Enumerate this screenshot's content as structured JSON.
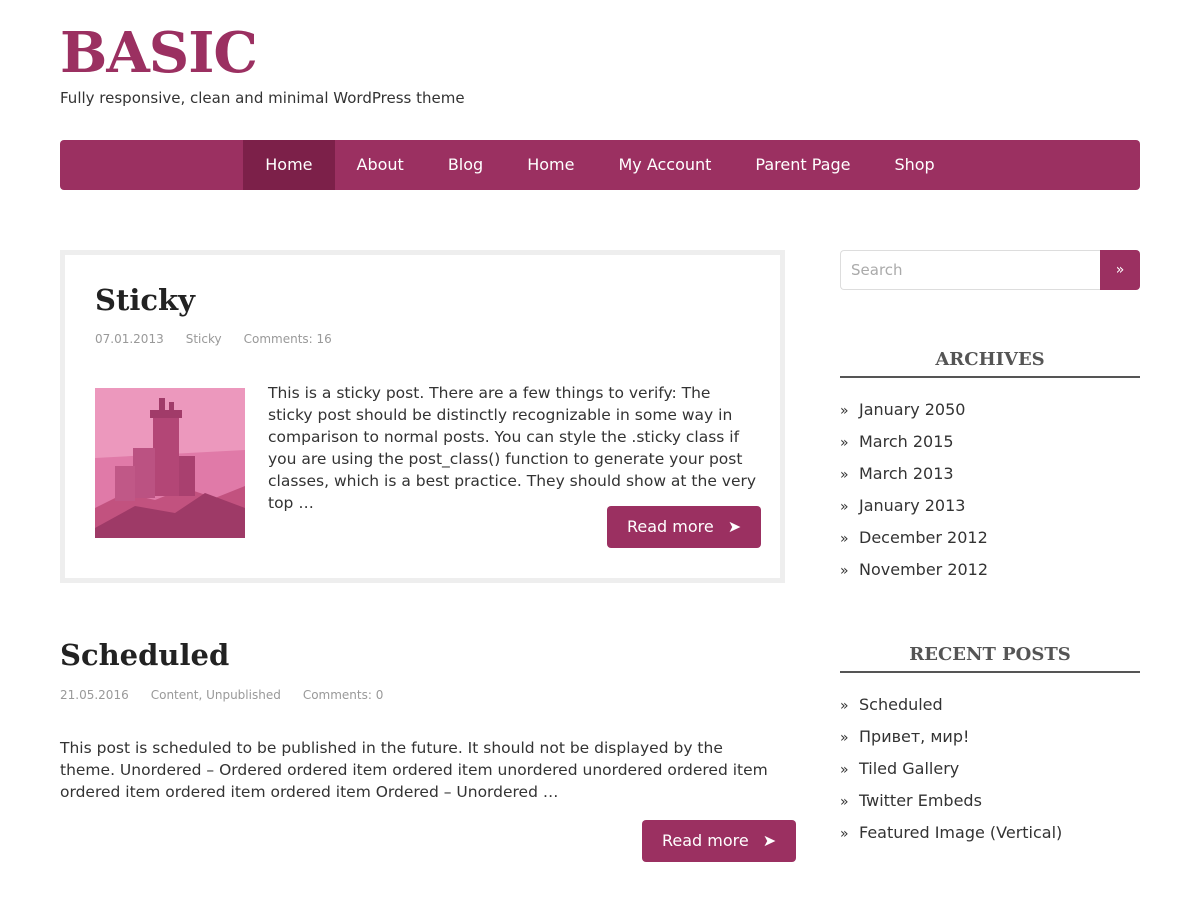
{
  "site": {
    "title": "BASIC",
    "description": "Fully responsive, clean and minimal WordPress theme"
  },
  "nav": {
    "items": [
      "Home",
      "About",
      "Blog",
      "Home",
      "My Account",
      "Parent Page",
      "Shop"
    ],
    "active_index": 0
  },
  "posts": [
    {
      "title": "Sticky",
      "date": "07.01.2013",
      "category": "Sticky",
      "comments": "Comments: 16",
      "excerpt": "This is a sticky post. There are a few things to verify: The sticky post should be distinctly recognizable in some way in comparison to normal posts. You can style the .sticky class if you are using the post_class() function to generate your post classes, which is a best practice. They should show at the very top …",
      "read_more": "Read more",
      "arrow": "➤"
    },
    {
      "title": "Scheduled",
      "date": "21.05.2016",
      "category": "Content, Unpublished",
      "comments": "Comments: 0",
      "excerpt": "This post is scheduled to be published in the future. It should not be displayed by the theme. Unordered – Ordered ordered item ordered item unordered unordered ordered item ordered item ordered item ordered item Ordered – Unordered …",
      "read_more": "Read more",
      "arrow": "➤"
    }
  ],
  "sidebar": {
    "search": {
      "placeholder": "Search",
      "button": "»"
    },
    "archives": {
      "title": "ARCHIVES",
      "items": [
        "January 2050",
        "March 2015",
        "March 2013",
        "January 2013",
        "December 2012",
        "November 2012"
      ]
    },
    "recent_posts": {
      "title": "RECENT POSTS",
      "items": [
        "Scheduled",
        "Привет, мир!",
        "Tiled Gallery",
        "Twitter Embeds",
        "Featured Image (Vertical)"
      ]
    },
    "bullet": "»"
  },
  "colors": {
    "accent": "#9b3061",
    "accent_active": "#7c2049",
    "text": "#333333",
    "meta": "#999999"
  }
}
